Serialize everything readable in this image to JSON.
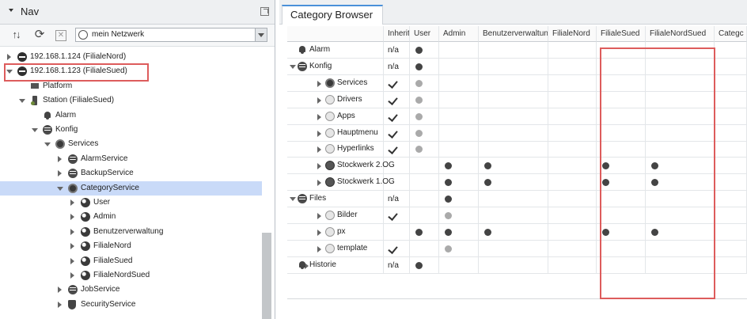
{
  "nav": {
    "title": "Nav",
    "toolbar": {
      "network_select": "mein Netzwerk"
    },
    "tree": [
      {
        "label": "192.168.1.124 (FilialeNord)",
        "icon": "host-icon",
        "expanded": false,
        "depth": 0
      },
      {
        "label": "192.168.1.123 (FilialeSued)",
        "icon": "host-icon",
        "expanded": true,
        "depth": 0
      },
      {
        "label": "Platform",
        "icon": "platform-icon",
        "expanded": null,
        "depth": 1
      },
      {
        "label": "Station (FilialeSued)",
        "icon": "station-icon",
        "expanded": true,
        "depth": 1
      },
      {
        "label": "Alarm",
        "icon": "bell-icon",
        "expanded": null,
        "depth": 2
      },
      {
        "label": "Konfig",
        "icon": "database-icon",
        "expanded": true,
        "depth": 2
      },
      {
        "label": "Services",
        "icon": "services-icon",
        "expanded": true,
        "depth": 3
      },
      {
        "label": "AlarmService",
        "icon": "alarm-service-icon",
        "expanded": false,
        "depth": 4
      },
      {
        "label": "BackupService",
        "icon": "backup-service-icon",
        "expanded": false,
        "depth": 4
      },
      {
        "label": "CategoryService",
        "icon": "category-service-icon",
        "expanded": true,
        "depth": 4,
        "selected": true
      },
      {
        "label": "User",
        "icon": "category-icon",
        "expanded": false,
        "depth": 5
      },
      {
        "label": "Admin",
        "icon": "category-icon",
        "expanded": false,
        "depth": 5
      },
      {
        "label": "Benutzerverwaltung",
        "icon": "category-icon",
        "expanded": false,
        "depth": 5
      },
      {
        "label": "FilialeNord",
        "icon": "category-icon",
        "expanded": false,
        "depth": 5
      },
      {
        "label": "FilialeSued",
        "icon": "category-icon",
        "expanded": false,
        "depth": 5
      },
      {
        "label": "FilialeNordSued",
        "icon": "category-icon",
        "expanded": false,
        "depth": 5
      },
      {
        "label": "JobService",
        "icon": "job-service-icon",
        "expanded": false,
        "depth": 4
      },
      {
        "label": "SecurityService",
        "icon": "shield-icon",
        "expanded": false,
        "depth": 4
      }
    ]
  },
  "category_browser": {
    "tab_label": "Category Browser",
    "columns": [
      "Inherit",
      "User",
      "Admin",
      "Benutzerverwaltung",
      "FilialeNord",
      "FilialeSued",
      "FilialeNordSued",
      "Categc"
    ],
    "rows": [
      {
        "label": "Alarm",
        "icon": "bell-icon",
        "caret": null,
        "depth": 0,
        "inherit": "n/a",
        "marks": [
          "black",
          "",
          "",
          "",
          "",
          "",
          ""
        ]
      },
      {
        "label": "Konfig",
        "icon": "database-icon",
        "caret": "open",
        "depth": 0,
        "inherit": "n/a",
        "marks": [
          "black",
          "",
          "",
          "",
          "",
          "",
          ""
        ]
      },
      {
        "label": "Services",
        "icon": "services-icon",
        "caret": "closed",
        "depth": 1,
        "inherit": "check",
        "marks": [
          "grey",
          "",
          "",
          "",
          "",
          "",
          ""
        ]
      },
      {
        "label": "Drivers",
        "icon": "drivers-icon",
        "caret": "closed",
        "depth": 1,
        "inherit": "check",
        "marks": [
          "grey",
          "",
          "",
          "",
          "",
          "",
          ""
        ]
      },
      {
        "label": "Apps",
        "icon": "apps-icon",
        "caret": "closed",
        "depth": 1,
        "inherit": "check",
        "marks": [
          "grey",
          "",
          "",
          "",
          "",
          "",
          ""
        ]
      },
      {
        "label": "Hauptmenu",
        "icon": "folder-icon",
        "caret": "closed",
        "depth": 1,
        "inherit": "check",
        "marks": [
          "grey",
          "",
          "",
          "",
          "",
          "",
          ""
        ]
      },
      {
        "label": "Hyperlinks",
        "icon": "folder-icon",
        "caret": "closed",
        "depth": 1,
        "inherit": "check",
        "marks": [
          "grey",
          "",
          "",
          "",
          "",
          "",
          ""
        ]
      },
      {
        "label": "Stockwerk 2.OG",
        "icon": "floor-icon",
        "caret": "closed",
        "depth": 1,
        "inherit": "",
        "marks": [
          "",
          "black",
          "black",
          "",
          "black",
          "black",
          ""
        ]
      },
      {
        "label": "Stockwerk 1.OG",
        "icon": "floor-icon",
        "caret": "closed",
        "depth": 1,
        "inherit": "",
        "marks": [
          "",
          "black",
          "black",
          "",
          "black",
          "black",
          ""
        ]
      },
      {
        "label": "Files",
        "icon": "files-icon",
        "caret": "open",
        "depth": 0,
        "inherit": "n/a",
        "marks": [
          "",
          "black",
          "",
          "",
          "",
          "",
          ""
        ]
      },
      {
        "label": "Bilder",
        "icon": "folder-icon",
        "caret": "closed",
        "depth": 1,
        "inherit": "check",
        "marks": [
          "",
          "grey",
          "",
          "",
          "",
          "",
          ""
        ]
      },
      {
        "label": "px",
        "icon": "folder-icon",
        "caret": "closed",
        "depth": 1,
        "inherit": "",
        "marks": [
          "black",
          "black",
          "black",
          "",
          "black",
          "black",
          ""
        ]
      },
      {
        "label": "template",
        "icon": "folder-icon",
        "caret": "closed",
        "depth": 1,
        "inherit": "check",
        "marks": [
          "",
          "grey",
          "",
          "",
          "",
          "",
          ""
        ]
      },
      {
        "label": "Historie",
        "icon": "history-icon",
        "caret": "closed",
        "depth": 0,
        "inherit": "n/a",
        "marks": [
          "black",
          "",
          "",
          "",
          "",
          "",
          ""
        ]
      }
    ]
  },
  "colors": {
    "highlight_box": "#dd5c5c",
    "selection": "#c9daf8",
    "tab_accent": "#4a90d9"
  }
}
